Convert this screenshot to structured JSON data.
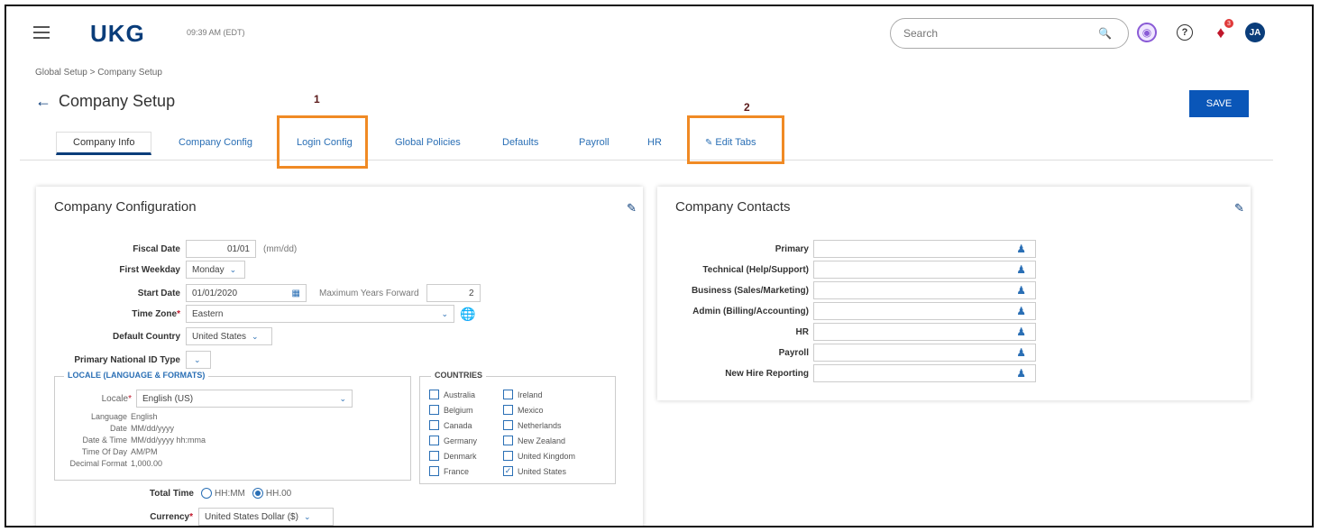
{
  "header": {
    "logo": "UKG",
    "time": "09:39 AM (EDT)",
    "search_placeholder": "Search",
    "notification_count": "3",
    "avatar_initials": "JA"
  },
  "breadcrumb": "Global Setup > Company Setup",
  "page_title": "Company Setup",
  "save_label": "SAVE",
  "markers": {
    "one": "1",
    "two": "2"
  },
  "tabs": [
    "Company Info",
    "Company Config",
    "Login Config",
    "Global Policies",
    "Defaults",
    "Payroll",
    "HR",
    "Edit Tabs"
  ],
  "company_config": {
    "title": "Company Configuration",
    "fiscal_date": {
      "label": "Fiscal Date",
      "value": "01/01",
      "hint": "(mm/dd)"
    },
    "first_weekday": {
      "label": "First Weekday",
      "value": "Monday"
    },
    "start_date": {
      "label": "Start Date",
      "value": "01/01/2020",
      "max_years_label": "Maximum Years Forward",
      "max_years_value": "2"
    },
    "time_zone": {
      "label": "Time Zone",
      "value": "Eastern"
    },
    "default_country": {
      "label": "Default Country",
      "value": "United States"
    },
    "primary_national_id": {
      "label": "Primary National ID Type"
    },
    "locale_section": {
      "legend": "LOCALE (LANGUAGE & FORMATS)",
      "locale_label": "Locale",
      "locale_value": "English (US)",
      "info": [
        {
          "label": "Language",
          "value": "English"
        },
        {
          "label": "Date",
          "value": "MM/dd/yyyy"
        },
        {
          "label": "Date & Time",
          "value": "MM/dd/yyyy hh:mma"
        },
        {
          "label": "Time Of Day",
          "value": "AM/PM"
        },
        {
          "label": "Decimal Format",
          "value": "1,000.00"
        }
      ]
    },
    "countries": {
      "legend": "COUNTRIES",
      "col1": [
        {
          "name": "Australia",
          "checked": false
        },
        {
          "name": "Belgium",
          "checked": false
        },
        {
          "name": "Canada",
          "checked": false
        },
        {
          "name": "Germany",
          "checked": false
        },
        {
          "name": "Denmark",
          "checked": false
        },
        {
          "name": "France",
          "checked": false
        }
      ],
      "col2": [
        {
          "name": "Ireland",
          "checked": false
        },
        {
          "name": "Mexico",
          "checked": false
        },
        {
          "name": "Netherlands",
          "checked": false
        },
        {
          "name": "New Zealand",
          "checked": false
        },
        {
          "name": "United Kingdom",
          "checked": false
        },
        {
          "name": "United States",
          "checked": true
        }
      ]
    },
    "total_time": {
      "label": "Total Time",
      "opt1": "HH:MM",
      "opt2": "HH.00",
      "selected": "HH.00"
    },
    "currency": {
      "label": "Currency",
      "value": "United States Dollar ($)"
    }
  },
  "contacts": {
    "title": "Company Contacts",
    "rows": [
      "Primary",
      "Technical (Help/Support)",
      "Business (Sales/Marketing)",
      "Admin (Billing/Accounting)",
      "HR",
      "Payroll",
      "New Hire Reporting"
    ]
  },
  "colors": {
    "brand": "#0a3d7a",
    "link": "#2a6fb5",
    "callout": "#f08a24",
    "save": "#0a56b8"
  }
}
